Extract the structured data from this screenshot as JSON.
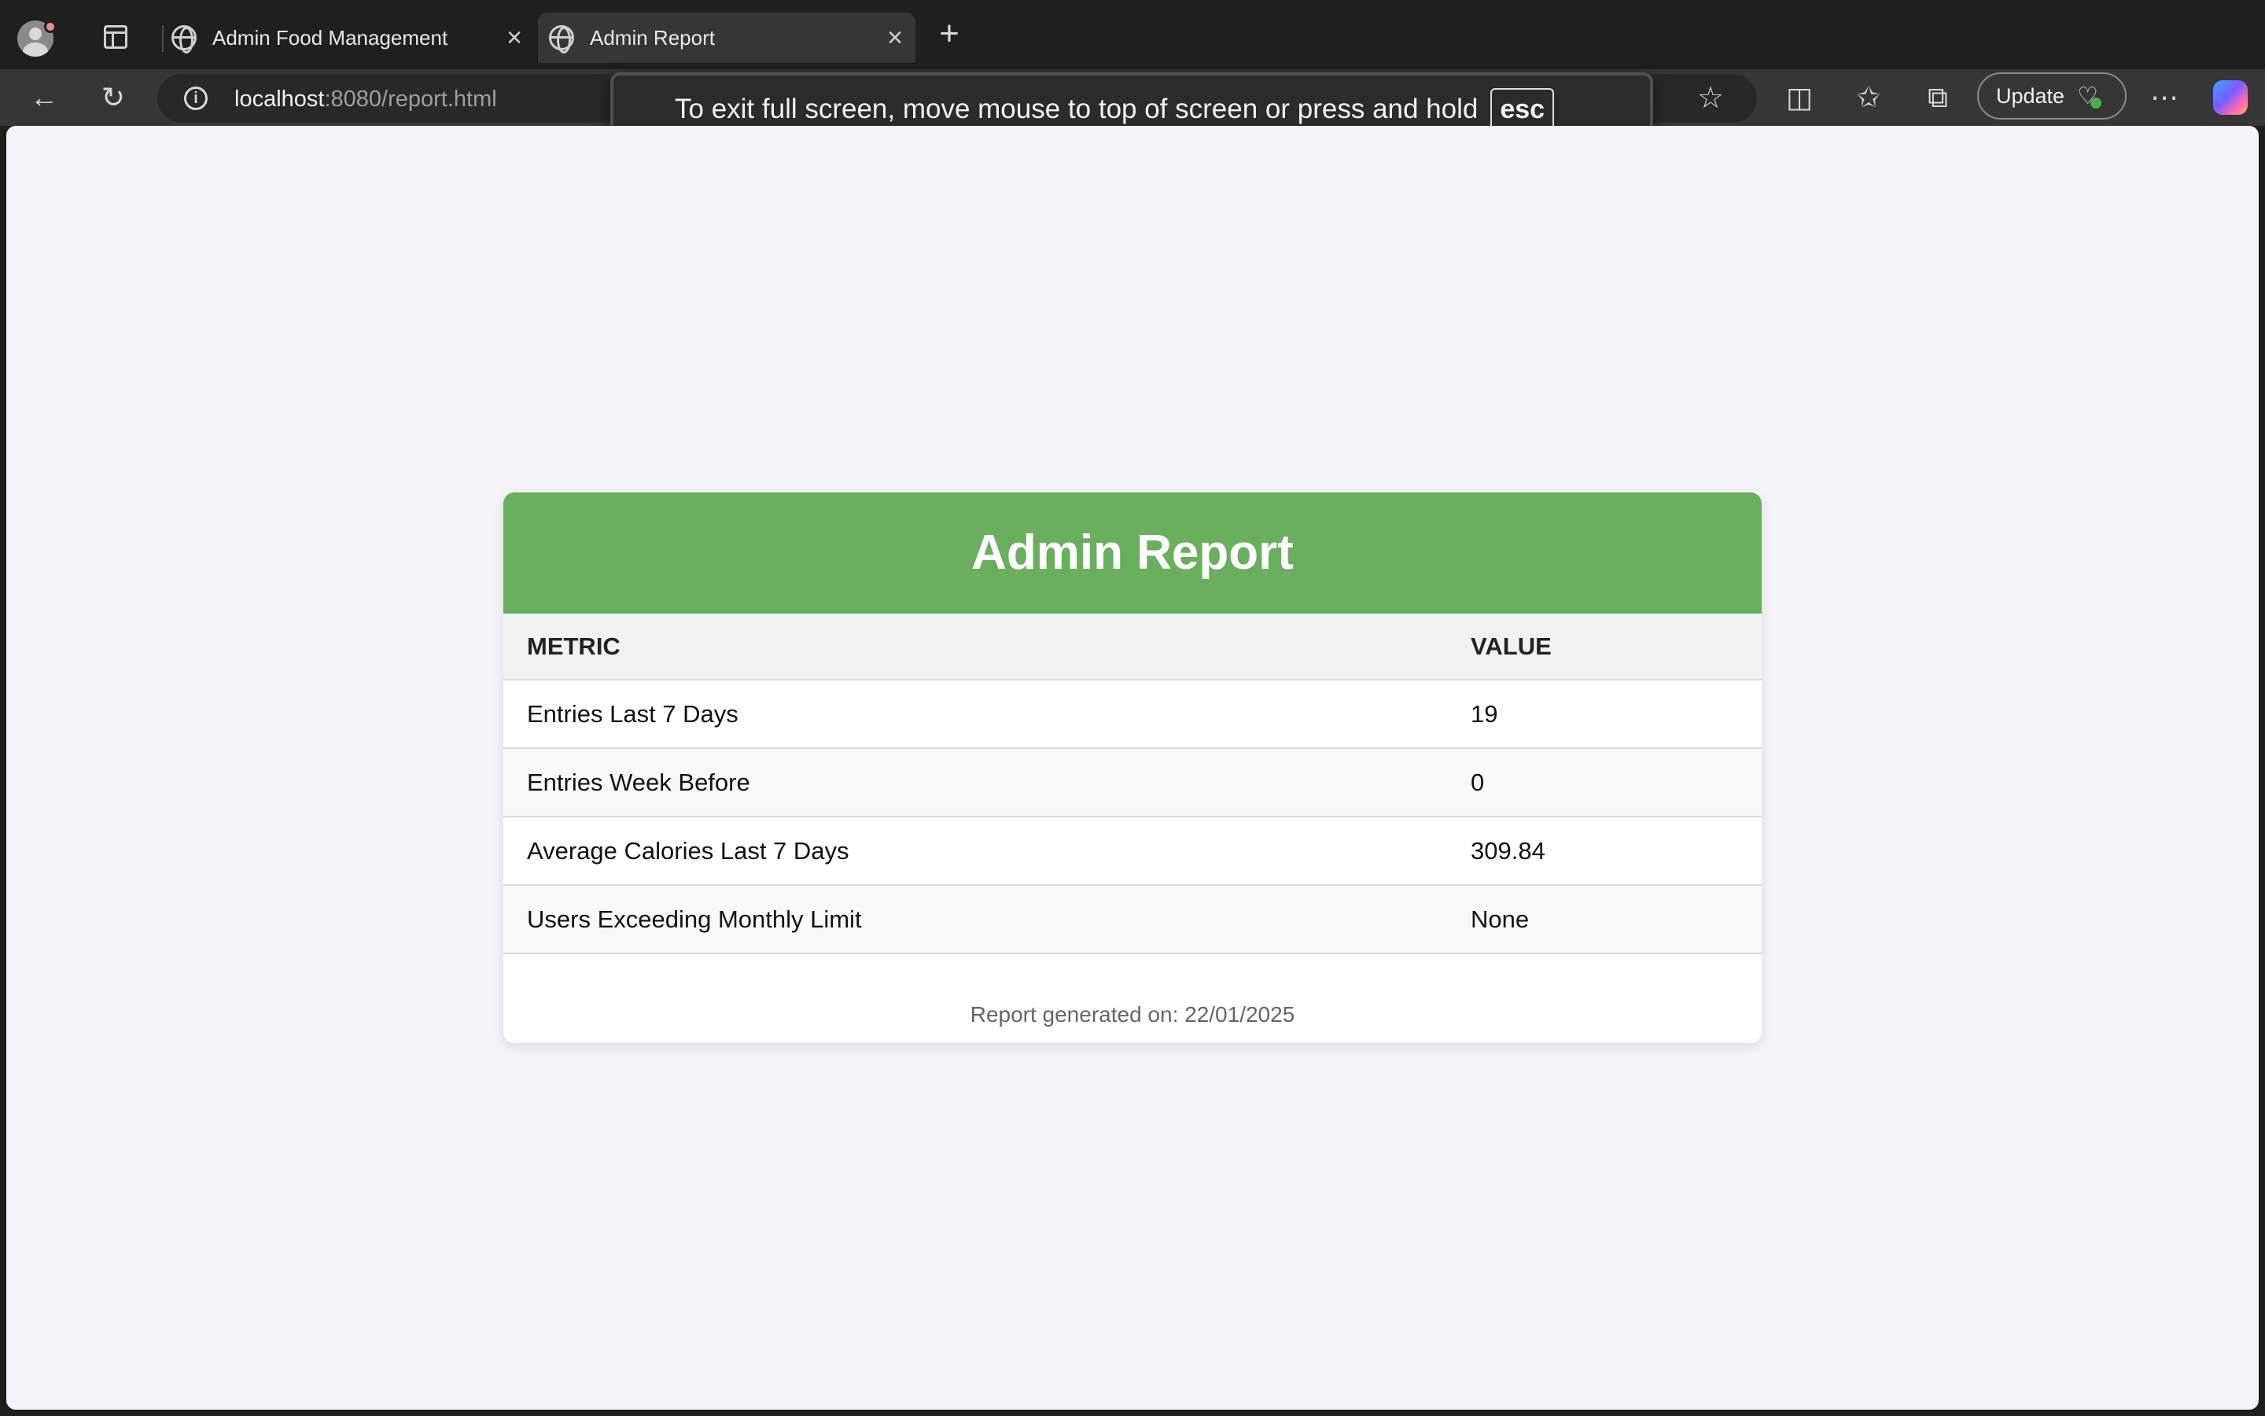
{
  "browser": {
    "tabs": [
      {
        "title": "Admin Food Management",
        "active": false
      },
      {
        "title": "Admin Report",
        "active": true
      }
    ],
    "url": {
      "host": "localhost",
      "path": ":8080/report.html"
    },
    "update_label": "Update",
    "fullscreen_notice": {
      "text": "To exit full screen, move mouse to top of screen or press and hold",
      "key": "esc"
    }
  },
  "report": {
    "title": "Admin Report",
    "columns": [
      "METRIC",
      "VALUE"
    ],
    "rows": [
      {
        "metric": "Entries Last 7 Days",
        "value": "19"
      },
      {
        "metric": "Entries Week Before",
        "value": "0"
      },
      {
        "metric": "Average Calories Last 7 Days",
        "value": "309.84"
      },
      {
        "metric": "Users Exceeding Monthly Limit",
        "value": "None"
      }
    ],
    "footer": "Report generated on: 22/01/2025"
  },
  "colors": {
    "header_green": "#69af5d",
    "page_bg": "#f4f4f8"
  },
  "icons": [
    "profile-icon",
    "tab-actions-icon",
    "globe-icon",
    "close-icon",
    "plus-icon",
    "back-icon",
    "refresh-icon",
    "info-icon",
    "read-aloud-icon",
    "favorite-star-icon",
    "split-screen-icon",
    "favorites-icon",
    "collections-icon",
    "health-icon",
    "more-icon",
    "copilot-icon"
  ]
}
